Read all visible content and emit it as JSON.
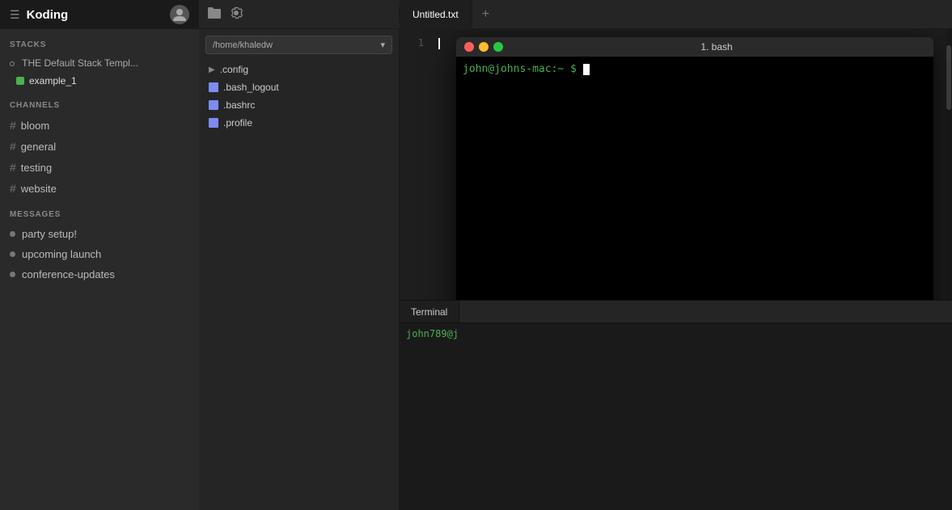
{
  "app": {
    "name": "Koding"
  },
  "sidebar": {
    "stacks_label": "STACKS",
    "channels_label": "CHANNELS",
    "messages_label": "MESSAGES",
    "stack": {
      "name": "THE Default Stack Templ...",
      "machine": "example_1"
    },
    "channels": [
      {
        "id": "bloom",
        "label": "bloom"
      },
      {
        "id": "general",
        "label": "general"
      },
      {
        "id": "testing",
        "label": "testing"
      },
      {
        "id": "website",
        "label": "website"
      }
    ],
    "messages": [
      {
        "id": "party-setup",
        "label": "party setup!"
      },
      {
        "id": "upcoming-launch",
        "label": "upcoming launch"
      },
      {
        "id": "conference-updates",
        "label": "conference-updates"
      }
    ]
  },
  "topbar": {
    "folder_icon": "📁",
    "settings_icon": "⚙"
  },
  "tabs": [
    {
      "id": "untitled",
      "label": "Untitled.txt",
      "active": true
    },
    {
      "id": "add",
      "label": "+"
    }
  ],
  "file_tree": {
    "path": "/home/khaledw",
    "items": [
      {
        "id": "config",
        "label": ".config",
        "type": "folder"
      },
      {
        "id": "bash_logout",
        "label": ".bash_logout",
        "type": "file"
      },
      {
        "id": "bashrc",
        "label": ".bashrc",
        "type": "file"
      },
      {
        "id": "profile",
        "label": ".profile",
        "type": "file"
      }
    ]
  },
  "editor": {
    "line_1": "1",
    "cursor_line": 1
  },
  "terminal": {
    "tab_label": "Terminal",
    "prompt_text": "john789@j"
  },
  "bash_window": {
    "title": "1. bash",
    "prompt": "john@johns-mac:~ $",
    "input": ""
  }
}
